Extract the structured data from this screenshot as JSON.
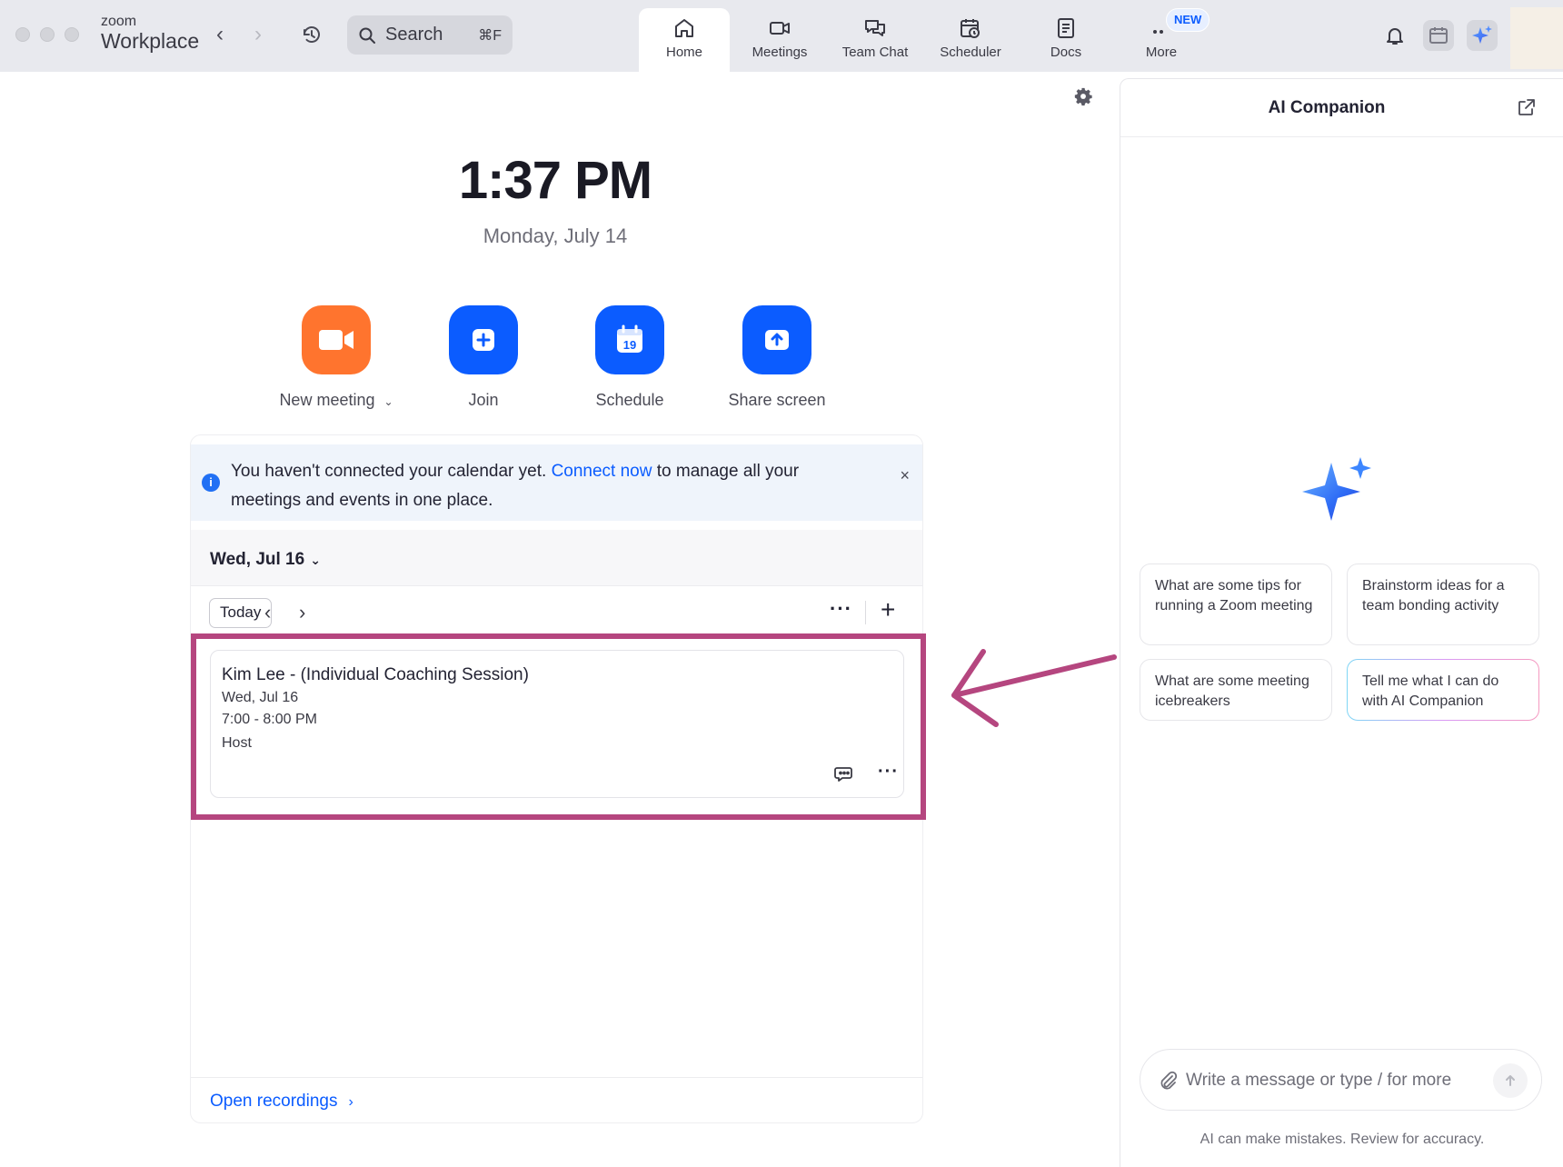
{
  "app": {
    "brand_small": "zoom",
    "brand_big": "Workplace"
  },
  "search": {
    "label": "Search",
    "shortcut": "⌘F"
  },
  "tabs": [
    {
      "label": "Home",
      "icon": "home-icon",
      "active": true
    },
    {
      "label": "Meetings",
      "icon": "video-camera-icon"
    },
    {
      "label": "Team Chat",
      "icon": "chat-bubbles-icon"
    },
    {
      "label": "Scheduler",
      "icon": "calendar-clock-icon"
    },
    {
      "label": "Docs",
      "icon": "document-icon"
    },
    {
      "label": "More",
      "icon": "more-dots-icon",
      "badge": "NEW"
    }
  ],
  "clock": {
    "time": "1:37 PM",
    "date": "Monday, July 14"
  },
  "actions": [
    {
      "label": "New meeting",
      "icon": "video-camera-icon",
      "color": "#ff742e"
    },
    {
      "label": "Join",
      "icon": "plus-icon",
      "color": "#0b5cff"
    },
    {
      "label": "Schedule",
      "icon": "calendar-icon",
      "color": "#0b5cff",
      "calendar_day": "19"
    },
    {
      "label": "Share screen",
      "icon": "share-up-arrow-icon",
      "color": "#0b5cff"
    }
  ],
  "banner": {
    "text_before": "You haven't connected your calendar yet. ",
    "link": "Connect now",
    "text_after": " to manage all your meetings and events in one place.",
    "close": "×"
  },
  "calendar": {
    "date_label": "Wed, Jul 16",
    "today_button": "Today"
  },
  "event": {
    "title": "Kim Lee - (Individual Coaching Session)",
    "date": "Wed, Jul 16",
    "time": "7:00 - 8:00 PM",
    "role": "Host"
  },
  "footer": {
    "open_recordings": "Open recordings"
  },
  "ai": {
    "title": "AI Companion",
    "suggestions": [
      "What are some tips for running a Zoom meeting",
      "Brainstorm ideas for a team bonding activity",
      "What are some meeting icebreakers",
      "Tell me what I can do with AI Companion"
    ],
    "input_placeholder": "Write a message or type / for more",
    "disclaimer": "AI can make mistakes. Review for accuracy."
  },
  "colors": {
    "accent": "#0b5cff",
    "orange": "#ff742e",
    "annotation": "#b5467f"
  }
}
